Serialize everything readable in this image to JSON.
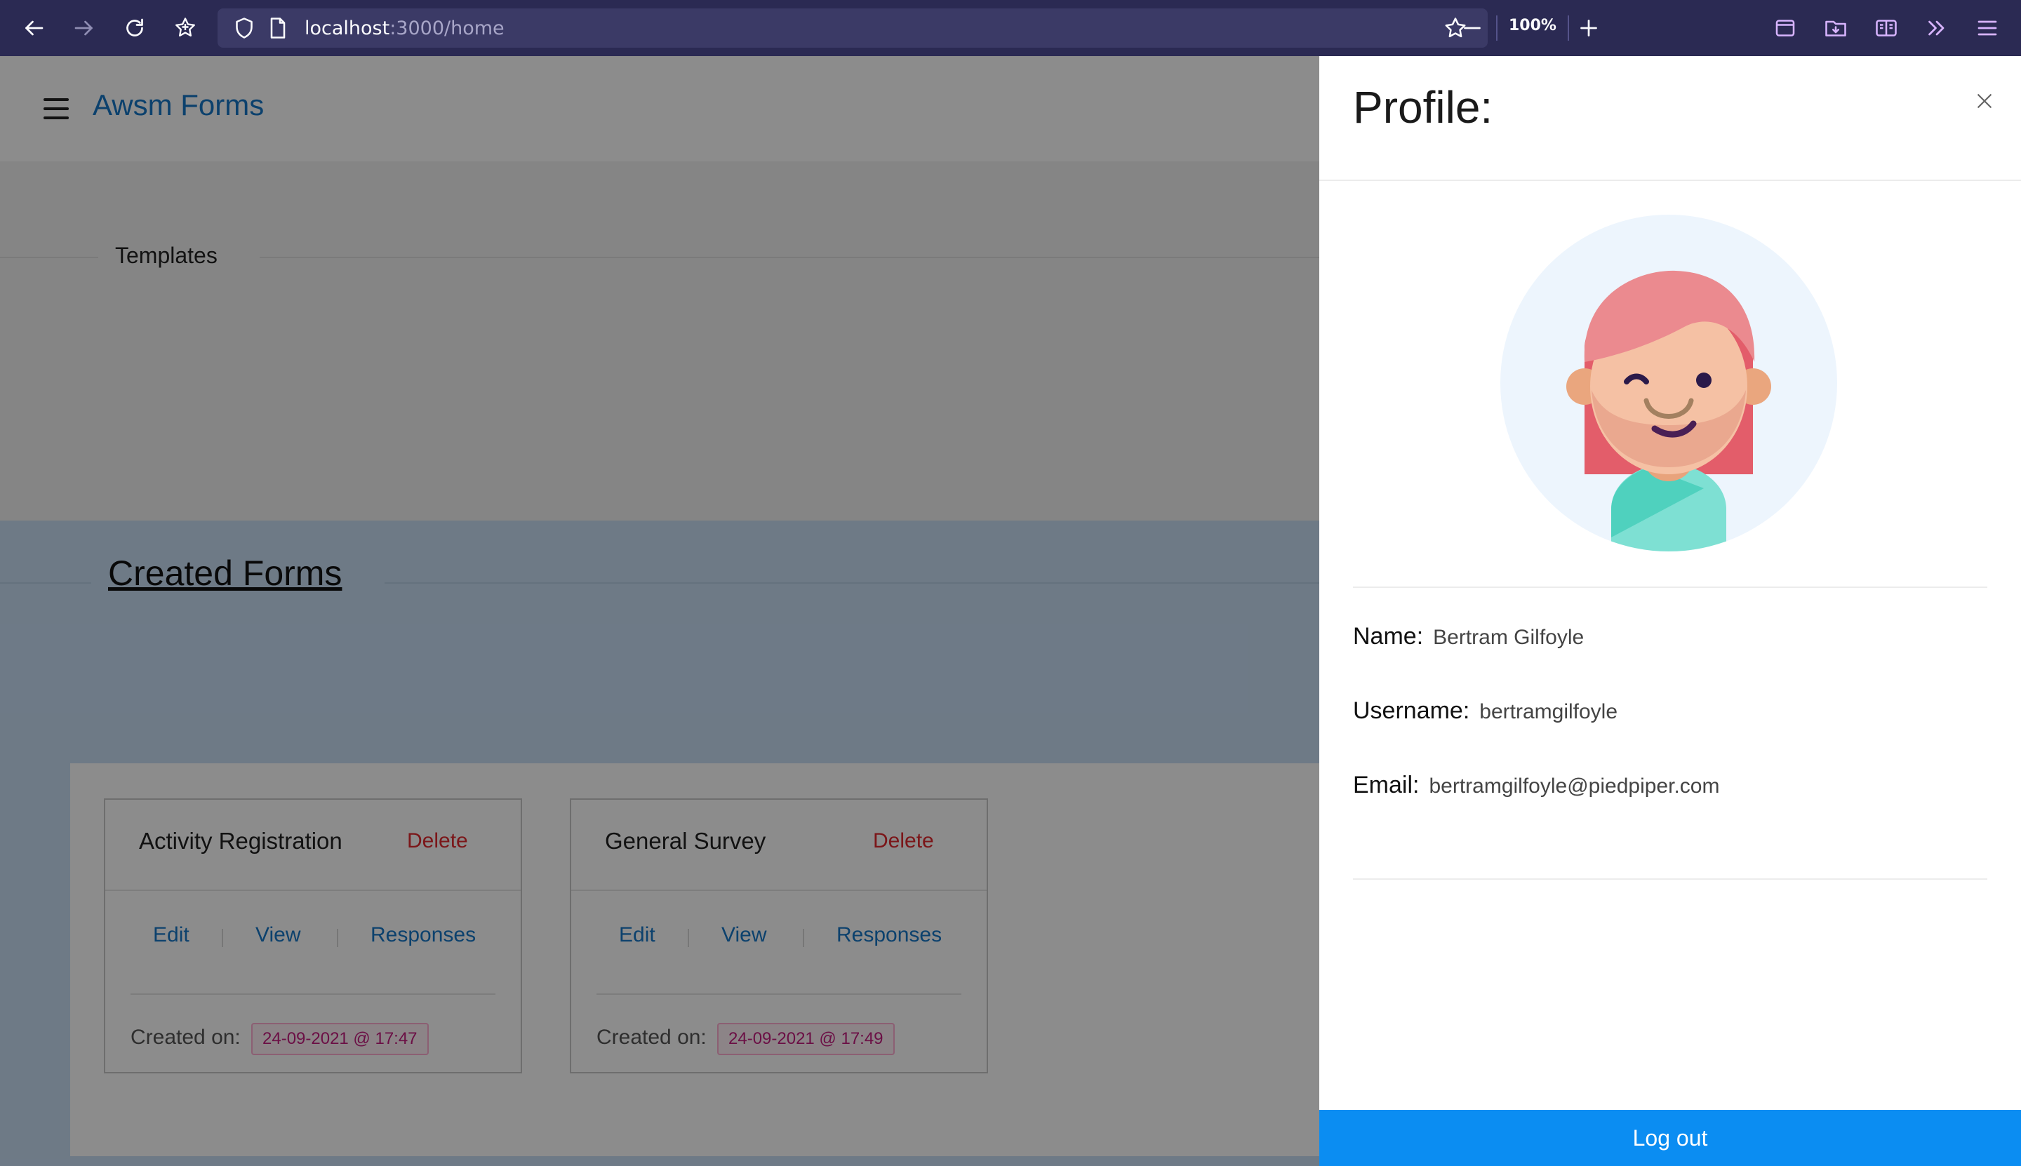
{
  "browser": {
    "url_host": "localhost",
    "url_path": ":3000/home",
    "zoom": "100%"
  },
  "app": {
    "title": "Awsm Forms",
    "templates_heading": "Templates",
    "created_forms_heading": "Created Forms",
    "forms": [
      {
        "title": "Activity Registration",
        "delete_label": "Delete",
        "edit_label": "Edit",
        "view_label": "View",
        "responses_label": "Responses",
        "created_label": "Created on:",
        "created_date": "24-09-2021 @ 17:47"
      },
      {
        "title": "General Survey",
        "delete_label": "Delete",
        "edit_label": "Edit",
        "view_label": "View",
        "responses_label": "Responses",
        "created_label": "Created on:",
        "created_date": "24-09-2021 @ 17:49"
      }
    ]
  },
  "profile": {
    "title": "Profile:",
    "name_label": "Name:",
    "name": "Bertram Gilfoyle",
    "username_label": "Username:",
    "username": "bertramgilfoyle",
    "email_label": "Email:",
    "email": "bertramgilfoyle@piedpiper.com",
    "logout_label": "Log out"
  },
  "colors": {
    "browser_toolbar": "#2b2a53",
    "brand_link": "#1677c7",
    "delete": "#e0282e",
    "logout_button": "#0b8df2",
    "forms_band": "#c9dff5"
  },
  "icons": [
    "back-icon",
    "forward-icon",
    "reload-icon",
    "extensions-icon",
    "shield-icon",
    "page-icon",
    "bookmark-star-icon",
    "zoom-out-icon",
    "zoom-in-icon",
    "sidebar-icon",
    "downloads-icon",
    "reader-icon",
    "overflow-icon",
    "menu-icon",
    "hamburger-icon",
    "close-icon"
  ]
}
